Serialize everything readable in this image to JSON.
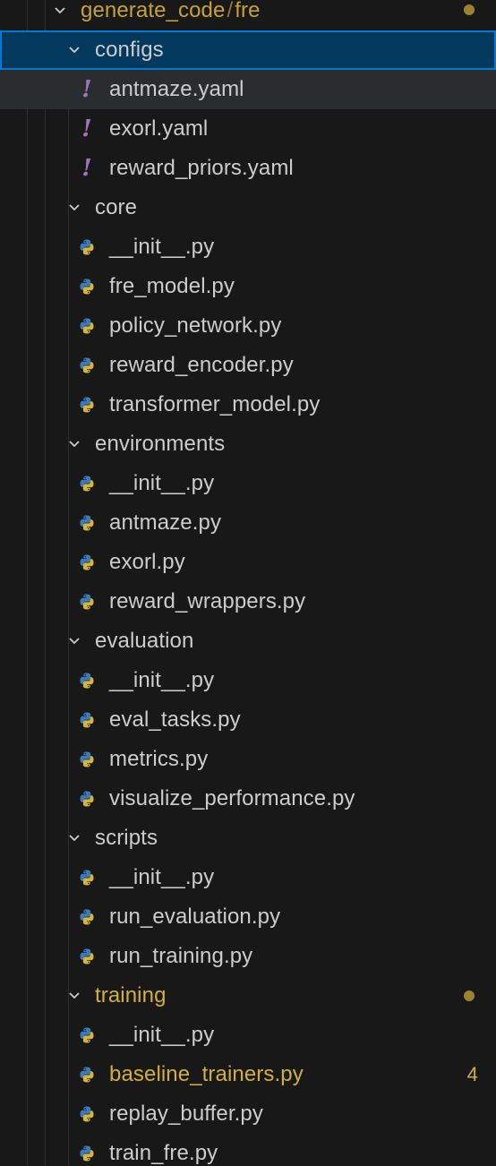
{
  "colors": {
    "background": "#181818",
    "selected_row": "#04395e",
    "selected_border": "#0078d4",
    "hover_row": "#2a2d2e",
    "text": "#cccccc",
    "modified": "#d2b038",
    "yaml_icon": "#a074c4",
    "python_blue": "#3b7bbf",
    "python_yellow": "#d4b43a"
  },
  "header": {
    "path_part1": "generate_code",
    "path_sep": "/",
    "path_part2": "fre"
  },
  "tree": [
    {
      "type": "folder",
      "label": "configs",
      "state": "expanded",
      "selected": true
    },
    {
      "type": "file",
      "icon": "yaml-icon",
      "label": "antmaze.yaml",
      "hovered": true
    },
    {
      "type": "file",
      "icon": "yaml-icon",
      "label": "exorl.yaml"
    },
    {
      "type": "file",
      "icon": "yaml-icon",
      "label": "reward_priors.yaml"
    },
    {
      "type": "folder",
      "label": "core",
      "state": "expanded"
    },
    {
      "type": "file",
      "icon": "python-icon",
      "label": "__init__.py"
    },
    {
      "type": "file",
      "icon": "python-icon",
      "label": "fre_model.py"
    },
    {
      "type": "file",
      "icon": "python-icon",
      "label": "policy_network.py"
    },
    {
      "type": "file",
      "icon": "python-icon",
      "label": "reward_encoder.py"
    },
    {
      "type": "file",
      "icon": "python-icon",
      "label": "transformer_model.py"
    },
    {
      "type": "folder",
      "label": "environments",
      "state": "expanded"
    },
    {
      "type": "file",
      "icon": "python-icon",
      "label": "__init__.py"
    },
    {
      "type": "file",
      "icon": "python-icon",
      "label": "antmaze.py"
    },
    {
      "type": "file",
      "icon": "python-icon",
      "label": "exorl.py"
    },
    {
      "type": "file",
      "icon": "python-icon",
      "label": "reward_wrappers.py"
    },
    {
      "type": "folder",
      "label": "evaluation",
      "state": "expanded"
    },
    {
      "type": "file",
      "icon": "python-icon",
      "label": "__init__.py"
    },
    {
      "type": "file",
      "icon": "python-icon",
      "label": "eval_tasks.py"
    },
    {
      "type": "file",
      "icon": "python-icon",
      "label": "metrics.py"
    },
    {
      "type": "file",
      "icon": "python-icon",
      "label": "visualize_performance.py"
    },
    {
      "type": "folder",
      "label": "scripts",
      "state": "expanded"
    },
    {
      "type": "file",
      "icon": "python-icon",
      "label": "__init__.py"
    },
    {
      "type": "file",
      "icon": "python-icon",
      "label": "run_evaluation.py"
    },
    {
      "type": "file",
      "icon": "python-icon",
      "label": "run_training.py"
    },
    {
      "type": "folder",
      "label": "training",
      "state": "expanded",
      "modified": true
    },
    {
      "type": "file",
      "icon": "python-icon",
      "label": "__init__.py"
    },
    {
      "type": "file",
      "icon": "python-icon",
      "label": "baseline_trainers.py",
      "modified": true,
      "badge": "4"
    },
    {
      "type": "file",
      "icon": "python-icon",
      "label": "replay_buffer.py"
    },
    {
      "type": "file",
      "icon": "python-icon",
      "label": "train_fre.py"
    }
  ]
}
